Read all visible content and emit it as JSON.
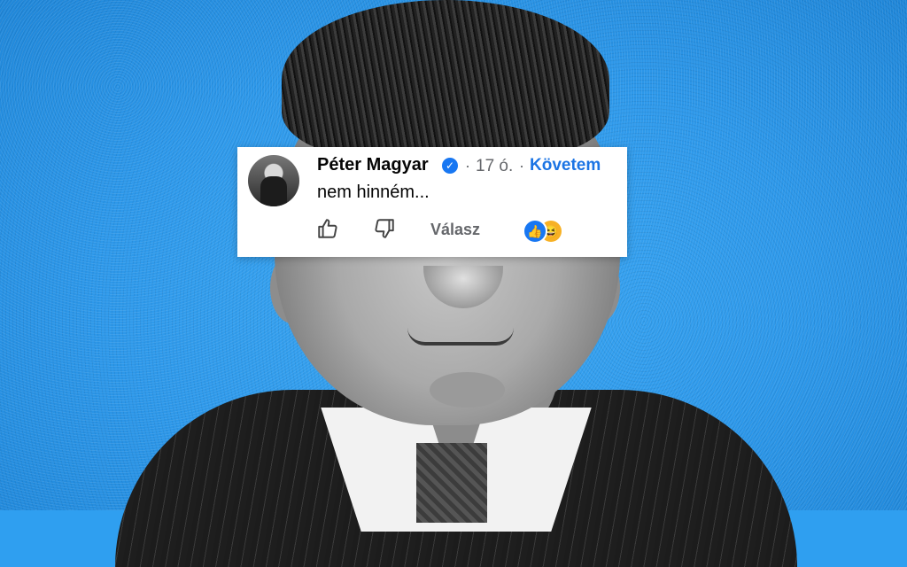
{
  "comment": {
    "author": "Péter Magyar",
    "time": "17 ó.",
    "separator": "·",
    "follow_label": "Követem",
    "text": "nem hinném...",
    "reply_label": "Válasz"
  },
  "icons": {
    "verified": "verified-badge-icon",
    "like": "thumbs-up-icon",
    "dislike": "thumbs-down-icon",
    "reaction_like": "like-reaction-icon",
    "reaction_haha": "haha-reaction-icon"
  },
  "colors": {
    "background": "#2f9ff0",
    "link": "#1b74e4",
    "verified": "#1877f2",
    "muted": "#65676b"
  }
}
